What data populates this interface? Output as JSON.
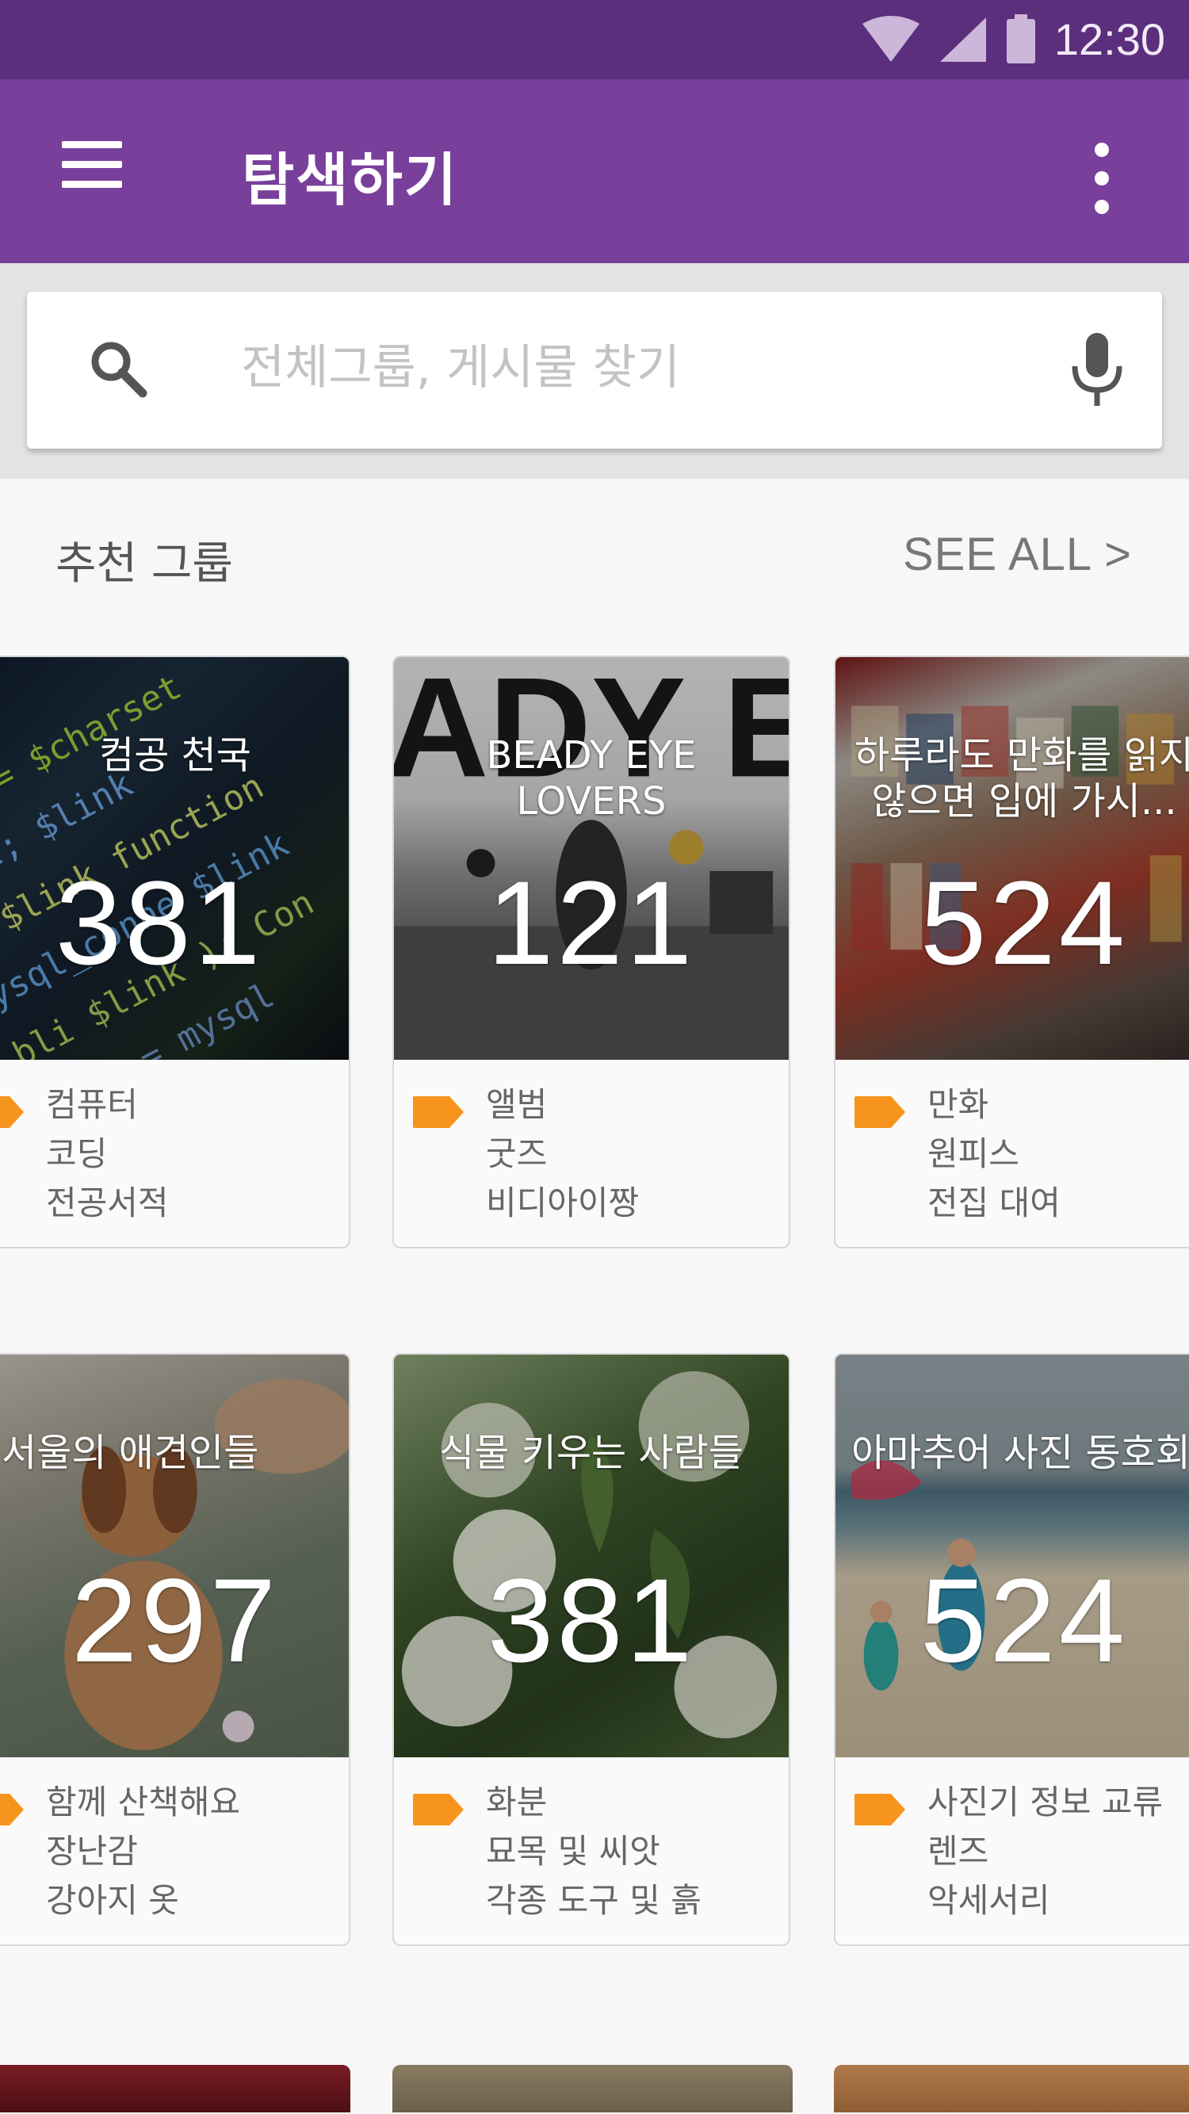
{
  "status": {
    "time": "12:30"
  },
  "appbar": {
    "title": "탐색하기"
  },
  "search": {
    "placeholder": "전체그룹, 게시물 찾기"
  },
  "section": {
    "title": "추천 그룹",
    "see_all": "SEE ALL >"
  },
  "cards": [
    {
      "title_lines": [
        "컴공 천국"
      ],
      "count": "381",
      "tags": [
        "컴퓨터",
        "코딩",
        "전공서적"
      ]
    },
    {
      "title_lines": [
        "BEADY EYE",
        "LOVERS"
      ],
      "count": "121",
      "tags": [
        "앨범",
        "굿즈",
        "비디아이짱"
      ]
    },
    {
      "title_lines": [
        "하루라도 만화를 읽지",
        "않으면 입에 가시..."
      ],
      "count": "524",
      "tags": [
        "만화",
        "원피스",
        "전집 대여"
      ]
    },
    {
      "title_lines": [
        "서울의 애견인들"
      ],
      "count": "297",
      "tags": [
        "함께 산책해요",
        "장난감",
        "강아지 옷"
      ]
    },
    {
      "title_lines": [
        "식물 키우는 사람들"
      ],
      "count": "381",
      "tags": [
        "화분",
        "묘목 및 씨앗",
        "각종 도구 및 흙"
      ]
    },
    {
      "title_lines": [
        "아마추어 사진 동호회"
      ],
      "count": "524",
      "tags": [
        "사진기 정보 교류",
        "렌즈",
        "악세서리"
      ]
    }
  ],
  "colors": {
    "statusbar": "#5b2f7c",
    "appbar": "#783f9b",
    "tag_accent": "#f7941d"
  },
  "icons": [
    "wifi-icon",
    "signal-icon",
    "battery-icon",
    "menu-icon",
    "more-vert-icon",
    "search-icon",
    "mic-icon",
    "tag-icon"
  ]
}
